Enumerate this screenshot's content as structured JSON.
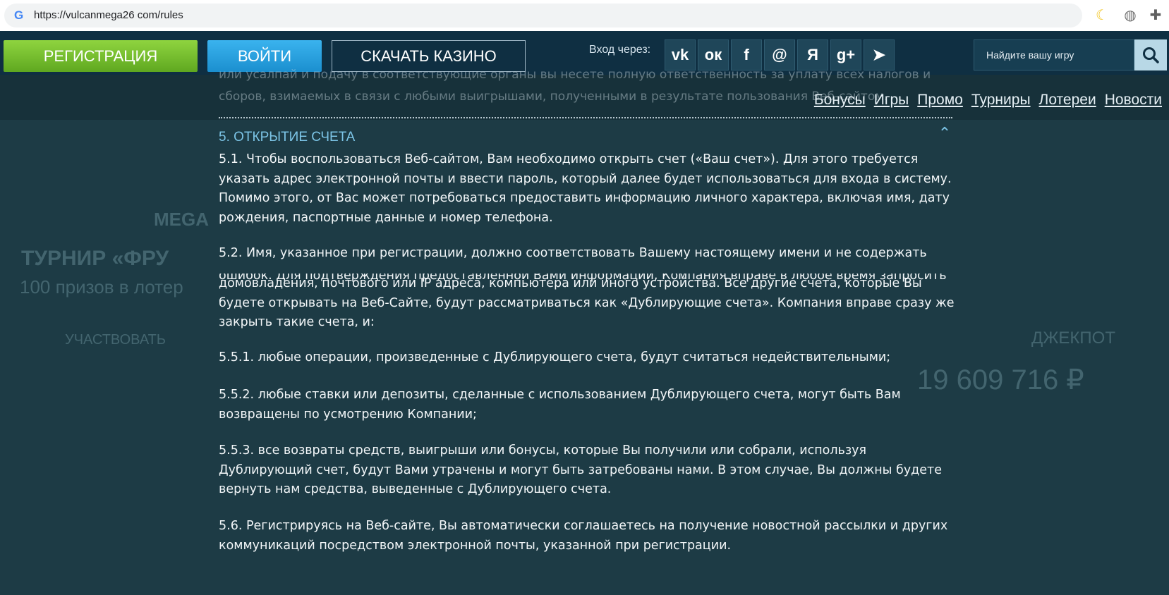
{
  "browser": {
    "url": "https://vulcanmega26 com/rules",
    "google_icon": "google-g-icon",
    "icons": [
      "moon-icon",
      "globe-icon",
      "puzzle-icon"
    ]
  },
  "header": {
    "register_label": "РЕГИСТРАЦИЯ",
    "login_label": "ВОЙТИ",
    "download_label": "СКАЧАТЬ КАЗИНО",
    "login_via_label": "Вход через:",
    "socials": [
      {
        "name": "vk-icon",
        "glyph": "vk"
      },
      {
        "name": "odnoklassniki-icon",
        "glyph": "ок"
      },
      {
        "name": "facebook-icon",
        "glyph": "f"
      },
      {
        "name": "mail-icon",
        "glyph": "@"
      },
      {
        "name": "yandex-icon",
        "glyph": "Я"
      },
      {
        "name": "google-plus-icon",
        "glyph": "g+"
      },
      {
        "name": "telegram-icon",
        "glyph": "➤"
      }
    ],
    "search_placeholder": "Найдите вашу игру"
  },
  "nav": {
    "items": [
      "Бонусы",
      "Игры",
      "Промо",
      "Турниры",
      "Лотереи",
      "Новости"
    ]
  },
  "background": {
    "tournament": "ТУРНИР «ФРУ",
    "prizes": "100 призов в лотер",
    "participate": "УЧАСТВОВАТЬ",
    "jackpot_label": "ДЖЕКПОТ",
    "jackpot_value": "19 609 716 ₽",
    "mega": "MEGA"
  },
  "content": {
    "prev_line1": "или усалпай и подачу в соответствующие органы вы несете полную ответственность за уплату всех налогов и",
    "prev_line2": "сборов, взимаемых в связи с любыми выигрышами, полученными в результате пользования Веб-сайтом.",
    "section_title": "5. ОТКРЫТИЕ СЧЕТА",
    "p51": [
      "5.1. Чтобы воспользоваться Веб-сайтом, Вам необходимо открыть счет («Ваш счет»). Для этого требуется",
      "указать адрес электронной почты и ввести пароль, который далее будет использоваться для входа в систему.",
      "Помимо этого, от Вас может потребоваться предоставить информацию личного характера, включая имя, дату",
      "рождения, паспортные данные и номер телефона."
    ],
    "p52": [
      "5.2. Имя, указанное при регистрации, должно соответствовать Вашему настоящему имени и не содержать"
    ],
    "p52_cut": "ошибок. Для подтверждения предоставленной Вами информации, Компания вправе в любое время запросить",
    "p55": [
      "домовладения, почтового или IP адреса, компьютера или иного устройства. Все другие счета, которые Вы",
      "будете открывать на Веб-Сайте, будут рассматриваться как «Дублирующие счета». Компания вправе сразу же",
      "закрыть такие счета, и:"
    ],
    "p551": [
      "5.5.1. любые операции, произведенные с Дублирующего счета, будут считаться недействительными;"
    ],
    "p552": [
      "5.5.2. любые ставки или депозиты, сделанные с использованием Дублирующего счета, могут быть Вам",
      "возвращены по усмотрению Компании;"
    ],
    "p553": [
      "5.5.3. все возвраты средств, выигрыши или бонусы, которые Вы получили или собрали, используя",
      "Дублирующий счет, будут Вами утрачены и могут быть затребованы нами. В этом случае, Вы должны будете",
      "вернуть нам средства, выведенные с Дублирующего счета."
    ],
    "p56": [
      "5.6. Регистрируясь на Веб-сайте, Вы автоматически соглашаетесь на получение новостной рассылки и других",
      "коммуникаций посредством электронной почты, указанной при регистрации."
    ]
  }
}
